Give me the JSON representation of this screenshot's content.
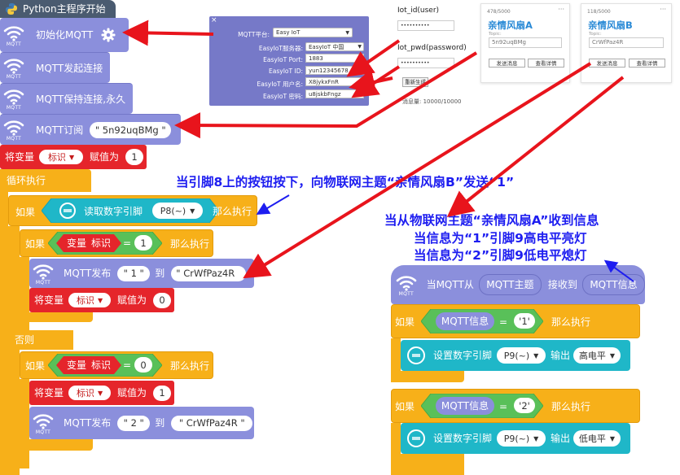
{
  "header": {
    "title": "Python主程序开始"
  },
  "blocks": {
    "mqtt_label": "MQTT",
    "init": "初始化MQTT",
    "connect": "MQTT发起连接",
    "keepalive": "MQTT保持连接,永久",
    "subscribe": "MQTT订阅",
    "subscribe_topic": "\" 5n92uqBMg \"",
    "set_var": "将变量",
    "var_name": "标识",
    "assign": "赋值为",
    "init_value": "1",
    "loop": "循环执行",
    "if": "如果",
    "then": "那么执行",
    "else": "否则",
    "read_pin": "读取数字引脚",
    "pin8": "P8(~)",
    "var_label": "变量",
    "eq": "=",
    "val1": "1",
    "val0": "0",
    "publish": "MQTT发布",
    "to": "到",
    "pub_msg1": "\" 1 \"",
    "pub_msg2": "\" 2 \"",
    "pub_topic": "\" CrWfPaz4R \"",
    "pub_topic_short": "\" CrWfPaz4R",
    "when_recv": "当MQTT从",
    "mqtt_topic": "MQTT主题",
    "recv": "接收到",
    "mqtt_msg": "MQTT信息",
    "msg_1": "'1'",
    "msg_2": "'2'",
    "set_pin": "设置数字引脚",
    "pin9": "P9(~)",
    "output": "输出",
    "high": "高电平",
    "low": "低电平"
  },
  "config_panel": {
    "platform_label": "MQTT平台:",
    "platform_value": "Easy IoT",
    "server_label": "EasyIoT服务器:",
    "server_value": "EasyIoT 中国",
    "port_label": "EasyIoT Port:",
    "port_value": "1883",
    "id_label": "EasyIoT ID:",
    "id_value": "yun12345678",
    "user_label": "EasyIoT 用户名:",
    "user_value": "X8jykxFnR",
    "pwd_label": "EasyIoT 密码:",
    "pwd_value": "u8jskbFngz"
  },
  "login_panel": {
    "user_label": "Iot_id(user)",
    "pwd_label": "Iot_pwd(password)",
    "masked": "••••••••••",
    "regen_button": "重新生成",
    "quota": "消息量: 10000/10000"
  },
  "cards": [
    {
      "count": "478/5000",
      "title": "亲情风扇A",
      "topic_label": "Topic:",
      "topic": "5n92uqBMg",
      "send": "发送消息",
      "detail": "查看详情",
      "menu": "···"
    },
    {
      "count": "118/5000",
      "title": "亲情风扇B",
      "topic_label": "Topic:",
      "topic": "CrWfPaz4R",
      "send": "发送消息",
      "detail": "查看详情",
      "menu": "···"
    }
  ],
  "annotations": {
    "a1": "当引脚8上的按钮按下，向物联网主题“亲情风扇B”发送“1”",
    "a2": "当从物联网主题“亲情风扇A”收到信息",
    "a3": "当信息为“1”引脚9高电平亮灯",
    "a4": "当信息为“2”引脚9低电平熄灯"
  },
  "colors": {
    "mqtt": "#8b8fdc",
    "loop": "#f7b019",
    "variable": "#e5252b",
    "logic": "#59c059",
    "io": "#1fb7c8",
    "annotation": "#1d1df0",
    "arrow": "#e8141c"
  }
}
